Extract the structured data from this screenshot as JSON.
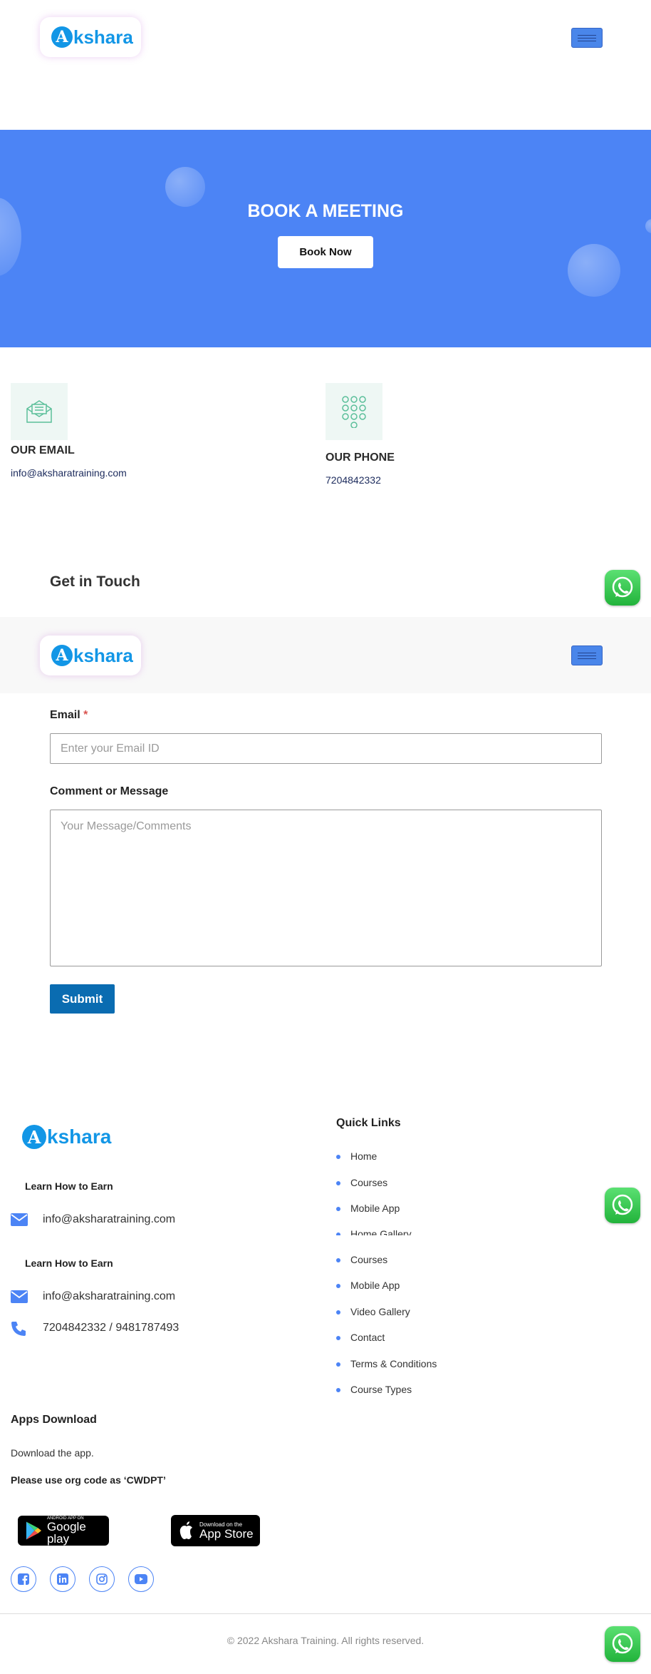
{
  "header": {
    "logo_letter": "A",
    "logo_text": "kshara"
  },
  "hero": {
    "title": "BOOK A MEETING",
    "button_label": "Book Now"
  },
  "contact": {
    "email_label": "OUR EMAIL",
    "email_value": "info@aksharatraining.com",
    "phone_label": "OUR PHONE",
    "phone_value": "7204842332"
  },
  "form": {
    "section_title": "Get in Touch",
    "email_label": "Email",
    "email_required_mark": "*",
    "email_placeholder": "Enter your Email ID",
    "message_label": "Comment or Message",
    "message_placeholder": "Your Message/Comments",
    "submit_label": "Submit"
  },
  "footer": {
    "logo_letter": "A",
    "logo_text": "kshara",
    "group1_heading": "Learn How to Earn",
    "group1_email": "info@aksharatraining.com",
    "group2_heading": "Learn How to Earn",
    "group2_email": "info@aksharatraining.com",
    "group2_phone": "7204842332 / 9481787493",
    "quick_links_title": "Quick Links",
    "quick_links": [
      "Home",
      "Courses",
      "Mobile App",
      "Home Gallery",
      "Courses",
      "Mobile App",
      "Video Gallery",
      "Contact",
      "Terms & Conditions",
      "Course Types"
    ],
    "apps_title": "Apps Download",
    "apps_text": "Download the app.",
    "org_code_note": "Please use org code as ‘CWDPT’",
    "google_play_small": "ANDROID APP ON",
    "google_play_big": "Google play",
    "app_store_small": "Download on the",
    "app_store_big": "App Store",
    "social_icons": [
      "facebook-icon",
      "linkedin-icon",
      "instagram-icon",
      "youtube-icon"
    ],
    "copyright": "© 2022 Akshara Training. All rights reserved."
  },
  "colors": {
    "accent": "#4c84f5",
    "brand": "#1296e6",
    "submit": "#0a6cb1",
    "whatsapp": "#2bbf45"
  }
}
